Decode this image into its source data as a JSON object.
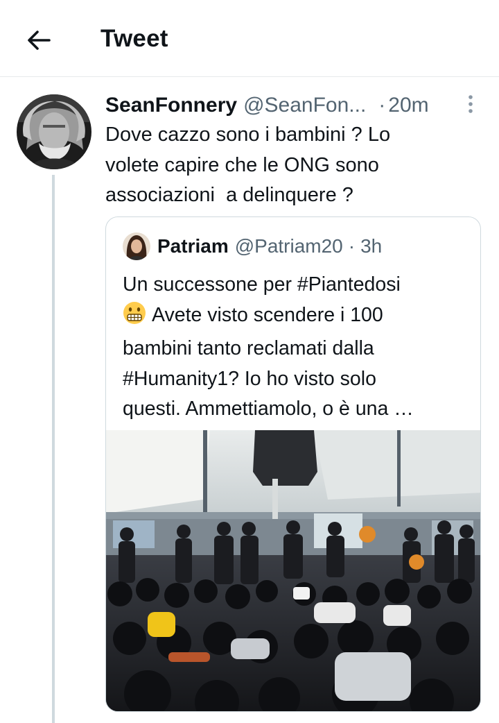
{
  "header": {
    "title": "Tweet",
    "back_icon": "arrow-left-icon"
  },
  "tweet": {
    "author_name": "SeanFonnery",
    "author_handle": "@SeanFon...",
    "separator": "·",
    "time": "20m",
    "more_icon": "more-vertical-icon",
    "text_lines": [
      "Dove cazzo sono i bambini ? Lo",
      "volete capire che le ONG sono",
      "associazioni  a delinquere ?"
    ]
  },
  "quote": {
    "author_name": "Patriam",
    "author_handle": "@Patriam20",
    "separator": "·",
    "time": "3h",
    "text_lines": [
      "Un successone per #Piantedosi",
      "Avete visto scendere i 100",
      "bambini tanto reclamati dalla",
      "#Humanity1? Io ho visto solo",
      "questi. Ammettiamolo, o è una …"
    ],
    "emoji": "grimacing-face-emoji",
    "media": "photo-crowd-on-ship-deck"
  },
  "colors": {
    "text": "#0f1419",
    "secondary": "#536471",
    "border": "#cfd9de",
    "thread_line": "#cfd9de"
  }
}
